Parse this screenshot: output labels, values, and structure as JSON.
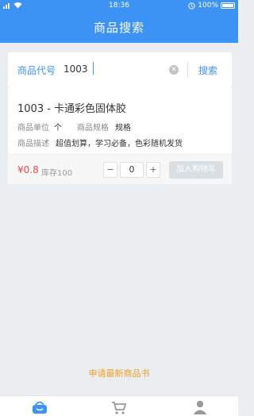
{
  "status_bar": {
    "time": "18:36",
    "battery": "100%",
    "icons": [
      "signal-icon",
      "wifi-icon",
      "alarm-icon",
      "battery-icon"
    ]
  },
  "navbar": {
    "title": "商品搜索"
  },
  "search": {
    "label": "商品代号",
    "value": "1003",
    "clear_icon": "clear-icon",
    "button_label": "搜索"
  },
  "product": {
    "title": "1003 - 卡通彩色固体胶",
    "unit_label": "商品单位",
    "unit_value": "个",
    "spec_label": "商品规格",
    "spec_value": "规格",
    "desc_label": "商品描述",
    "desc_value": "超值划算，学习必备，色彩随机发货",
    "price": "¥0.8",
    "stock": "库存100",
    "quantity": "0",
    "minus_label": "−",
    "plus_label": "+",
    "add_cart_label": "加入购物车"
  },
  "apply_link": "申请最新商品书",
  "tabbar": {
    "tabs": [
      {
        "name": "home",
        "icon": "basket-icon",
        "active": true
      },
      {
        "name": "cart",
        "icon": "cart-icon",
        "active": false
      },
      {
        "name": "profile",
        "icon": "user-icon",
        "active": false
      }
    ]
  },
  "colors": {
    "primary": "#3d93f4",
    "price": "#e5434b",
    "link": "#f0a020",
    "background": "#eaeef1"
  }
}
